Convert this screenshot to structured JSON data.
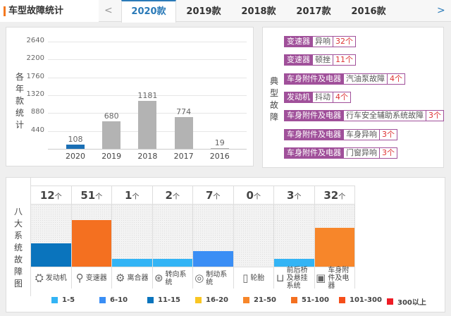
{
  "header": {
    "title": "车型故障统计",
    "prev": "<",
    "next": ">",
    "tabs": [
      "2020款",
      "2019款",
      "2018款",
      "2017款",
      "2016款"
    ],
    "active": 0
  },
  "chart_data": {
    "type": "bar",
    "ylabel": "各年款统计",
    "categories": [
      "2020",
      "2019",
      "2018",
      "2017",
      "2016"
    ],
    "values": [
      108,
      680,
      1181,
      774,
      19
    ],
    "ylim": [
      0,
      2640
    ],
    "yticks": [
      440,
      880,
      1320,
      1760,
      2200,
      2640
    ],
    "highlight_color": "#1a6fb5",
    "bar_color": "#b3b3b3"
  },
  "typical": {
    "label": "典型故障",
    "items": [
      {
        "component": "变速器",
        "desc": "异响",
        "count": "32个"
      },
      {
        "component": "变速器",
        "desc": "顿挫",
        "count": "11个"
      },
      {
        "component": "车身附件及电器",
        "desc": "汽油泵故障",
        "count": "4个"
      },
      {
        "component": "发动机",
        "desc": "抖动",
        "count": "4个"
      },
      {
        "component": "车身附件及电器",
        "desc": "行车安全辅助系统故障",
        "count": "3个"
      },
      {
        "component": "车身附件及电器",
        "desc": "车身异响",
        "count": "3个"
      },
      {
        "component": "车身附件及电器",
        "desc": "门窗异响",
        "count": "3个"
      }
    ]
  },
  "systems": {
    "label": "八大系统故障图",
    "unit": "个",
    "items": [
      {
        "name": "发动机",
        "count": "12",
        "level": 0.375,
        "color": "#0a74bd",
        "icon": "⛭"
      },
      {
        "name": "变速器",
        "count": "51",
        "level": 0.75,
        "color": "#f47020",
        "icon": "⚲"
      },
      {
        "name": "离合器",
        "count": "1",
        "level": 0.125,
        "color": "#33b4f5",
        "icon": "⚙"
      },
      {
        "name": "转向系统",
        "count": "2",
        "level": 0.125,
        "color": "#33b4f5",
        "icon": "⊛"
      },
      {
        "name": "制动系统",
        "count": "7",
        "level": 0.25,
        "color": "#3a8ef5",
        "icon": "◎"
      },
      {
        "name": "轮胎",
        "count": "0",
        "level": 0,
        "color": "#33b4f5",
        "icon": "▯"
      },
      {
        "name": "前后桥及悬挂系统",
        "count": "3",
        "level": 0.125,
        "color": "#33b4f5",
        "icon": "⊔"
      },
      {
        "name": "车身附件及电器",
        "count": "32",
        "level": 0.625,
        "color": "#f7862a",
        "icon": "▣"
      }
    ]
  },
  "legend": [
    {
      "label": "1-5",
      "color": "#33b4f5"
    },
    {
      "label": "6-10",
      "color": "#3a8ef5"
    },
    {
      "label": "11-15",
      "color": "#0a74bd"
    },
    {
      "label": "16-20",
      "color": "#f9c623"
    },
    {
      "label": "21-50",
      "color": "#f7862a"
    },
    {
      "label": "51-100",
      "color": "#f47020"
    },
    {
      "label": "101-300",
      "color": "#f54e1a"
    },
    {
      "label": "300以上",
      "color": "#ee1c25"
    }
  ]
}
